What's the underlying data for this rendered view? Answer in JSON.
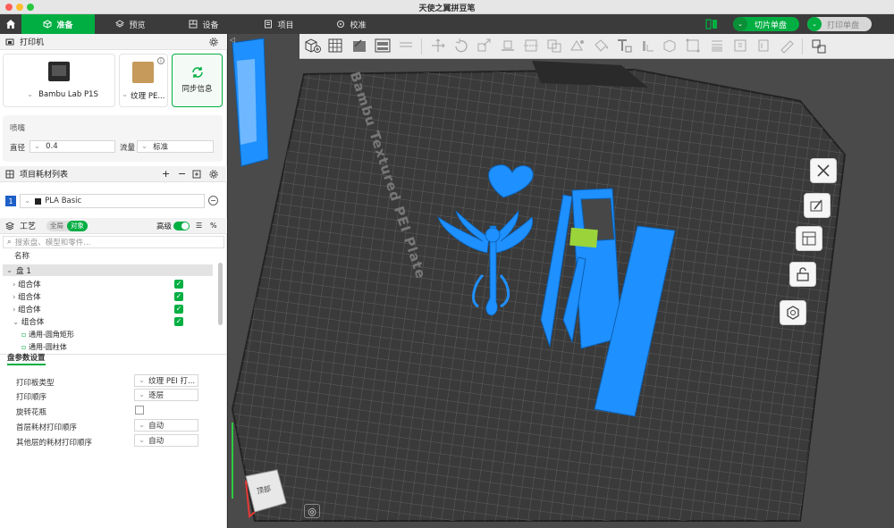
{
  "window": {
    "title": "天使之翼拼豆笔"
  },
  "topbar": {
    "tabs": [
      {
        "label": "准备",
        "icon": "cube-icon"
      },
      {
        "label": "预览",
        "icon": "layers-icon"
      },
      {
        "label": "设备",
        "icon": "device-icon"
      },
      {
        "label": "项目",
        "icon": "project-icon"
      },
      {
        "label": "校准",
        "icon": "calibrate-icon"
      }
    ],
    "slice_label": "切片单盘",
    "print_label": "打印单盘"
  },
  "printer": {
    "section_title": "打印机",
    "printer_name": "Bambu Lab P1S",
    "plate_name": "纹理 PE...",
    "sync_label": "同步信息",
    "nozzle_title": "喷嘴",
    "diameter_label": "直径",
    "diameter_value": "0.4",
    "flow_label": "流量",
    "flow_value": "标准"
  },
  "filament": {
    "section_title": "项目耗材列表",
    "items": [
      {
        "index": "1",
        "name": "PLA Basic",
        "color": "#222222"
      }
    ]
  },
  "process": {
    "section_title": "工艺",
    "toggle_global": "全局",
    "toggle_object": "对象",
    "advanced_label": "高级",
    "search_placeholder": "搜索盘、模型和零件...",
    "column_name": "名称",
    "plate_label": "盘 1",
    "tree": [
      {
        "label": "组合体",
        "checked": true
      },
      {
        "label": "组合体",
        "checked": true
      },
      {
        "label": "组合体",
        "checked": true
      },
      {
        "label": "组合体",
        "checked": true
      }
    ],
    "children": [
      "通用-圆角矩形",
      "通用-圆柱体"
    ]
  },
  "plate_settings": {
    "title": "盘参数设置",
    "rows": [
      {
        "label": "打印板类型",
        "value": "纹理 PEI 打..."
      },
      {
        "label": "打印顺序",
        "value": "逐层"
      },
      {
        "label": "旋转花瓶",
        "value": ""
      },
      {
        "label": "首层耗材打印顺序",
        "value": "自动"
      },
      {
        "label": "其他层的耗材打印顺序",
        "value": "自动"
      }
    ]
  },
  "viewport": {
    "plate_text": "Bambu Textured PEI Plate",
    "view_label": "顶部",
    "model_color": "#1e90ff",
    "plate_color": "#3a3a3a"
  }
}
